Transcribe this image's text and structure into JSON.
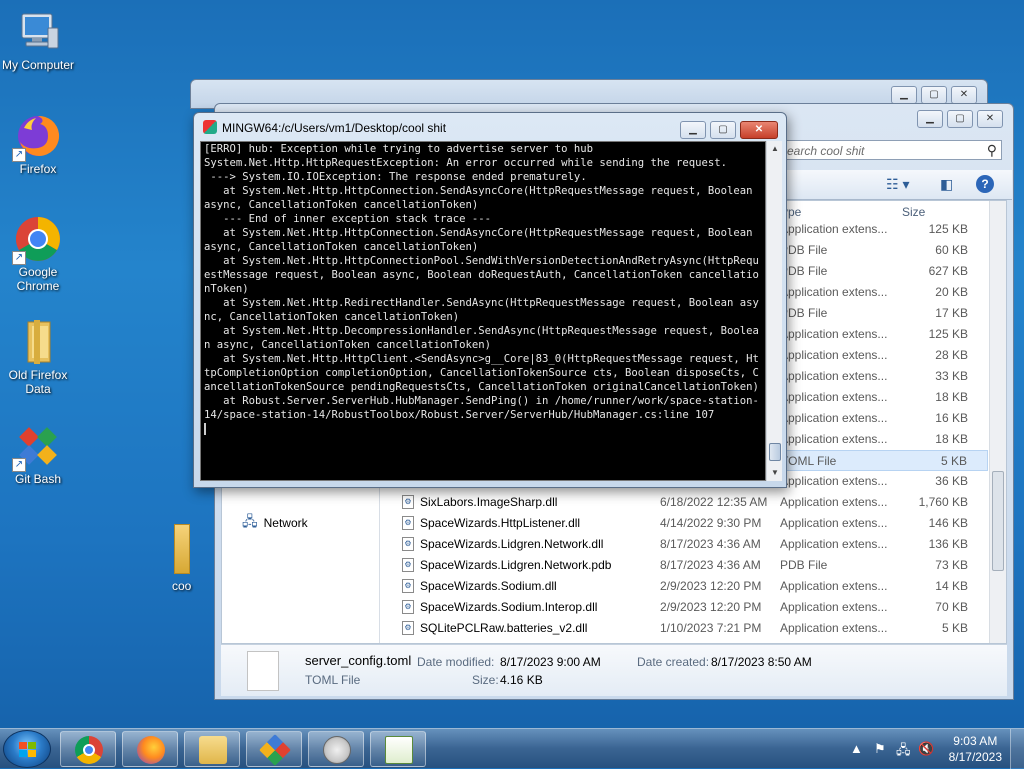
{
  "desktop": {
    "icons": [
      {
        "label": "My Computer"
      },
      {
        "label": "Firefox"
      },
      {
        "label": "Google Chrome"
      },
      {
        "label": "Old Firefox Data"
      },
      {
        "label": "Git Bash"
      }
    ],
    "peek_label": "coo"
  },
  "explorer": {
    "search_placeholder": "earch cool shit",
    "columns": {
      "type": "ype",
      "size": "Size"
    },
    "nav": {
      "network": "Network"
    },
    "rows": [
      {
        "name": "",
        "date": "",
        "type": "Application extens...",
        "size": "125 KB"
      },
      {
        "name": "",
        "date": "",
        "type": "PDB File",
        "size": "60 KB"
      },
      {
        "name": "",
        "date": "",
        "type": "PDB File",
        "size": "627 KB"
      },
      {
        "name": "",
        "date": "",
        "type": "Application extens...",
        "size": "20 KB"
      },
      {
        "name": "",
        "date": "",
        "type": "PDB File",
        "size": "17 KB"
      },
      {
        "name": "",
        "date": "",
        "type": "Application extens...",
        "size": "125 KB"
      },
      {
        "name": "",
        "date": "",
        "type": "Application extens...",
        "size": "28 KB"
      },
      {
        "name": "",
        "date": "",
        "type": "Application extens...",
        "size": "33 KB"
      },
      {
        "name": "",
        "date": "",
        "type": "Application extens...",
        "size": "18 KB"
      },
      {
        "name": "",
        "date": "",
        "type": "Application extens...",
        "size": "16 KB"
      },
      {
        "name": "",
        "date": "",
        "type": "Application extens...",
        "size": "18 KB"
      },
      {
        "name": "",
        "date": "",
        "type": "TOML File",
        "size": "5 KB"
      },
      {
        "name": "",
        "date": "",
        "type": "Application extens...",
        "size": "36 KB"
      },
      {
        "name": "SixLabors.ImageSharp.dll",
        "date": "6/18/2022 12:35 AM",
        "type": "Application extens...",
        "size": "1,760 KB"
      },
      {
        "name": "SpaceWizards.HttpListener.dll",
        "date": "4/14/2022 9:30 PM",
        "type": "Application extens...",
        "size": "146 KB"
      },
      {
        "name": "SpaceWizards.Lidgren.Network.dll",
        "date": "8/17/2023 4:36 AM",
        "type": "Application extens...",
        "size": "136 KB"
      },
      {
        "name": "SpaceWizards.Lidgren.Network.pdb",
        "date": "8/17/2023 4:36 AM",
        "type": "PDB File",
        "size": "73 KB"
      },
      {
        "name": "SpaceWizards.Sodium.dll",
        "date": "2/9/2023 12:20 PM",
        "type": "Application extens...",
        "size": "14 KB"
      },
      {
        "name": "SpaceWizards.Sodium.Interop.dll",
        "date": "2/9/2023 12:20 PM",
        "type": "Application extens...",
        "size": "70 KB"
      },
      {
        "name": "SQLitePCLRaw.batteries_v2.dll",
        "date": "1/10/2023 7:21 PM",
        "type": "Application extens...",
        "size": "5 KB"
      }
    ],
    "details": {
      "filename": "server_config.toml",
      "filetype": "TOML File",
      "modified_label": "Date modified:",
      "modified_value": "8/17/2023 9:00 AM",
      "created_label": "Date created:",
      "created_value": "8/17/2023 8:50 AM",
      "size_label": "Size:",
      "size_value": "4.16 KB"
    }
  },
  "terminal": {
    "title": "MINGW64:/c/Users/vm1/Desktop/cool shit",
    "output": "[ERRO] hub: Exception while trying to advertise server to hub\nSystem.Net.Http.HttpRequestException: An error occurred while sending the request.\n ---> System.IO.IOException: The response ended prematurely.\n   at System.Net.Http.HttpConnection.SendAsyncCore(HttpRequestMessage request, Boolean async, CancellationToken cancellationToken)\n   --- End of inner exception stack trace ---\n   at System.Net.Http.HttpConnection.SendAsyncCore(HttpRequestMessage request, Boolean async, CancellationToken cancellationToken)\n   at System.Net.Http.HttpConnectionPool.SendWithVersionDetectionAndRetryAsync(HttpRequestMessage request, Boolean async, Boolean doRequestAuth, CancellationToken cancellationToken)\n   at System.Net.Http.RedirectHandler.SendAsync(HttpRequestMessage request, Boolean async, CancellationToken cancellationToken)\n   at System.Net.Http.DecompressionHandler.SendAsync(HttpRequestMessage request, Boolean async, CancellationToken cancellationToken)\n   at System.Net.Http.HttpClient.<SendAsync>g__Core|83_0(HttpRequestMessage request, HttpCompletionOption completionOption, CancellationTokenSource cts, Boolean disposeCts, CancellationTokenSource pendingRequestsCts, CancellationToken originalCancellationToken)\n   at Robust.Server.ServerHub.HubManager.SendPing() in /home/runner/work/space-station-14/space-station-14/RobustToolbox/Robust.Server/ServerHub/HubManager.cs:line 107\n"
  },
  "taskbar": {
    "time": "9:03 AM",
    "date": "8/17/2023"
  },
  "colors": {
    "desktop": "#1d74c0",
    "console_bg": "#000000",
    "console_fg": "#e6e6e6"
  }
}
